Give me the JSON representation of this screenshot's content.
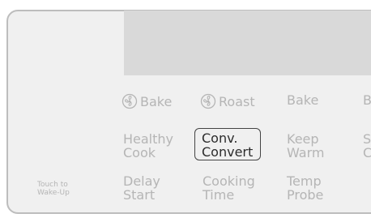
{
  "display": {
    "text": ""
  },
  "keys": {
    "fan_bake": "Bake",
    "fan_roast": "Roast",
    "bake": "Bake",
    "partial_b": "B",
    "healthy_cook": [
      "Healthy",
      "Cook"
    ],
    "conv_convert": [
      "Conv.",
      "Convert"
    ],
    "keep_warm": [
      "Keep",
      "Warm"
    ],
    "partial_sc": [
      "S",
      "C"
    ],
    "delay_start": [
      "Delay",
      "Start"
    ],
    "cooking_time": [
      "Cooking",
      "Time"
    ],
    "temp_probe": [
      "Temp",
      "Probe"
    ]
  },
  "wake_label": [
    "Touch to",
    "Wake-Up"
  ],
  "icons": {
    "convection": "convection-fan-icon"
  },
  "colors": {
    "panel": "#f0f0f0",
    "display": "#d9d9d9",
    "inactive_text": "#b5b5b5",
    "active_text": "#2b2b2b",
    "border": "#bdbdbd"
  }
}
